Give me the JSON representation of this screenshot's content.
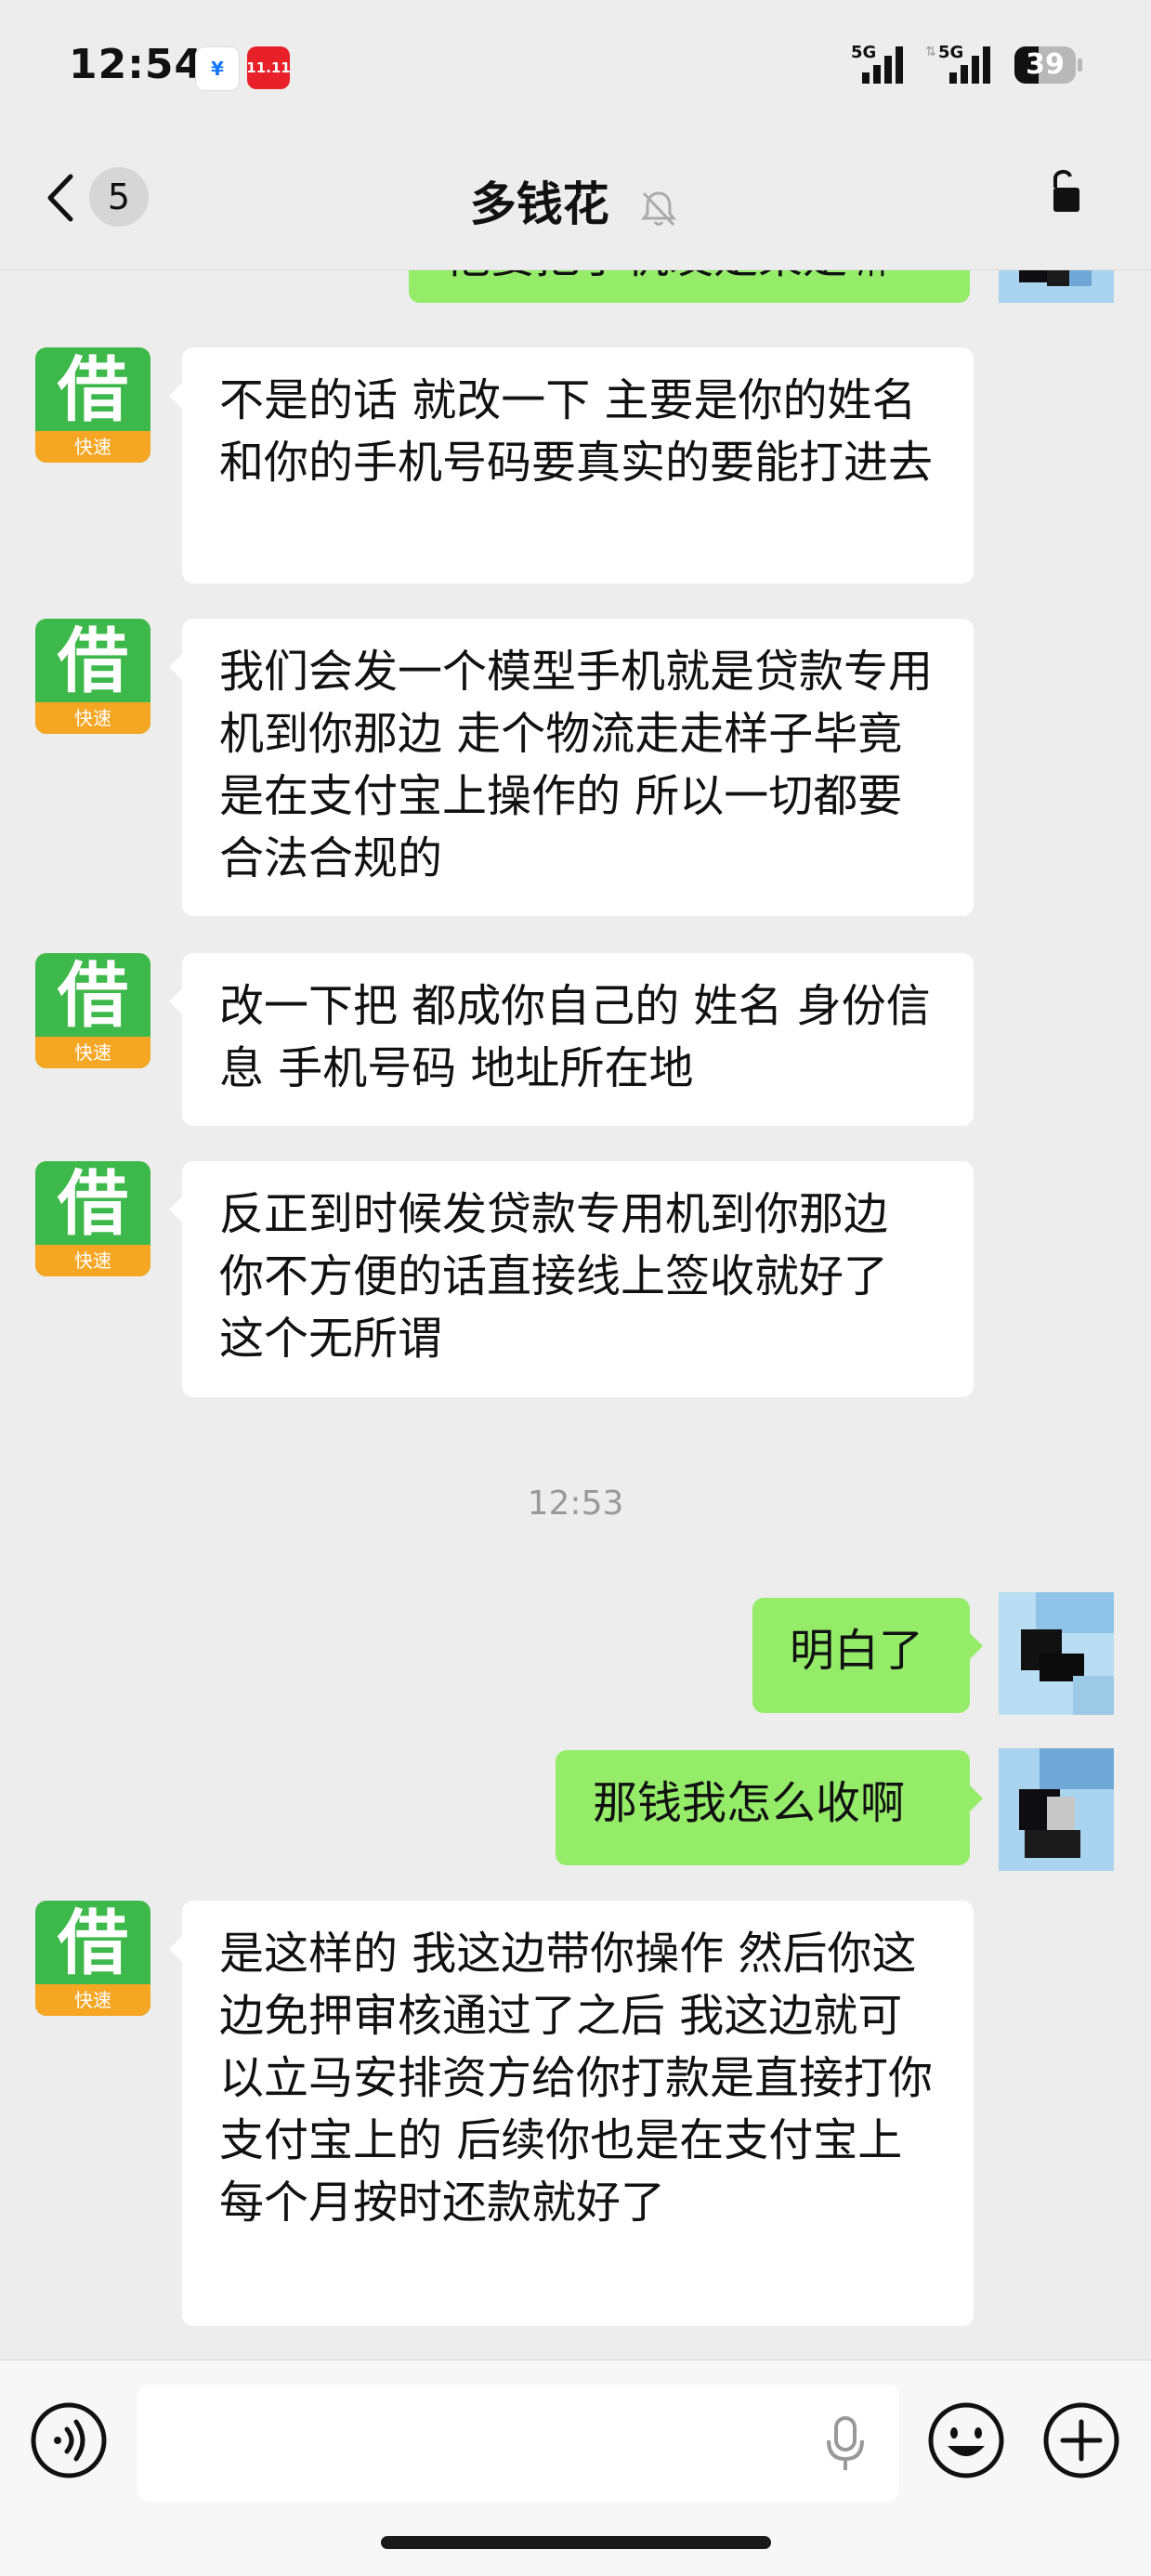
{
  "status_bar": {
    "time": "12:54",
    "app_icon_1": "¥",
    "app_icon_2": "11.11",
    "signal_1_label": "5G",
    "signal_2_label": "5G",
    "battery": "39"
  },
  "header": {
    "back_label": "<",
    "unread_count": "5",
    "title": "多钱花",
    "mute_icon": "bell-slash",
    "more_icon": "lock-open"
  },
  "messages": [
    {
      "side": "right",
      "text": "他要把手机发是某是嘛",
      "partial": true
    },
    {
      "side": "left",
      "avatar_char": "借",
      "avatar_sub": "快速",
      "text": "不是的话  就改一下  主要是你的姓名  和你的手机号码要真实的要能打进去"
    },
    {
      "side": "left",
      "avatar_char": "借",
      "avatar_sub": "快速",
      "text": "我们会发一个模型手机就是贷款专用机到你那边  走个物流走走样子毕竟是在支付宝上操作的  所以一切都要合法合规的"
    },
    {
      "side": "left",
      "avatar_char": "借",
      "avatar_sub": "快速",
      "text": "改一下把  都成你自己的  姓名  身份信息  手机号码  地址所在地"
    },
    {
      "side": "left",
      "avatar_char": "借",
      "avatar_sub": "快速",
      "text": "反正到时候发贷款专用机到你那边  你不方便的话直接线上签收就好了  这个无所谓"
    },
    {
      "type": "timestamp",
      "text": "12:53"
    },
    {
      "side": "right",
      "text": "明白了"
    },
    {
      "side": "right",
      "text": "那钱我怎么收啊"
    },
    {
      "side": "left",
      "avatar_char": "借",
      "avatar_sub": "快速",
      "text": "是这样的  我这边带你操作  然后你这边免押审核通过了之后  我这边就可以立马安排资方给你打款是直接打你支付宝上的  后续你也是在支付宝上每个月按时还款就好了"
    }
  ],
  "input_bar": {
    "voice_icon": "voice-toggle",
    "mic_icon": "microphone",
    "emoji_icon": "emoji",
    "plus_icon": "plus",
    "input_value": ""
  },
  "colors": {
    "background": "#ededed",
    "incoming_bubble": "#ffffff",
    "outgoing_bubble": "#95ec69",
    "avatar_green": "#3db84a",
    "avatar_orange": "#f5a623"
  }
}
